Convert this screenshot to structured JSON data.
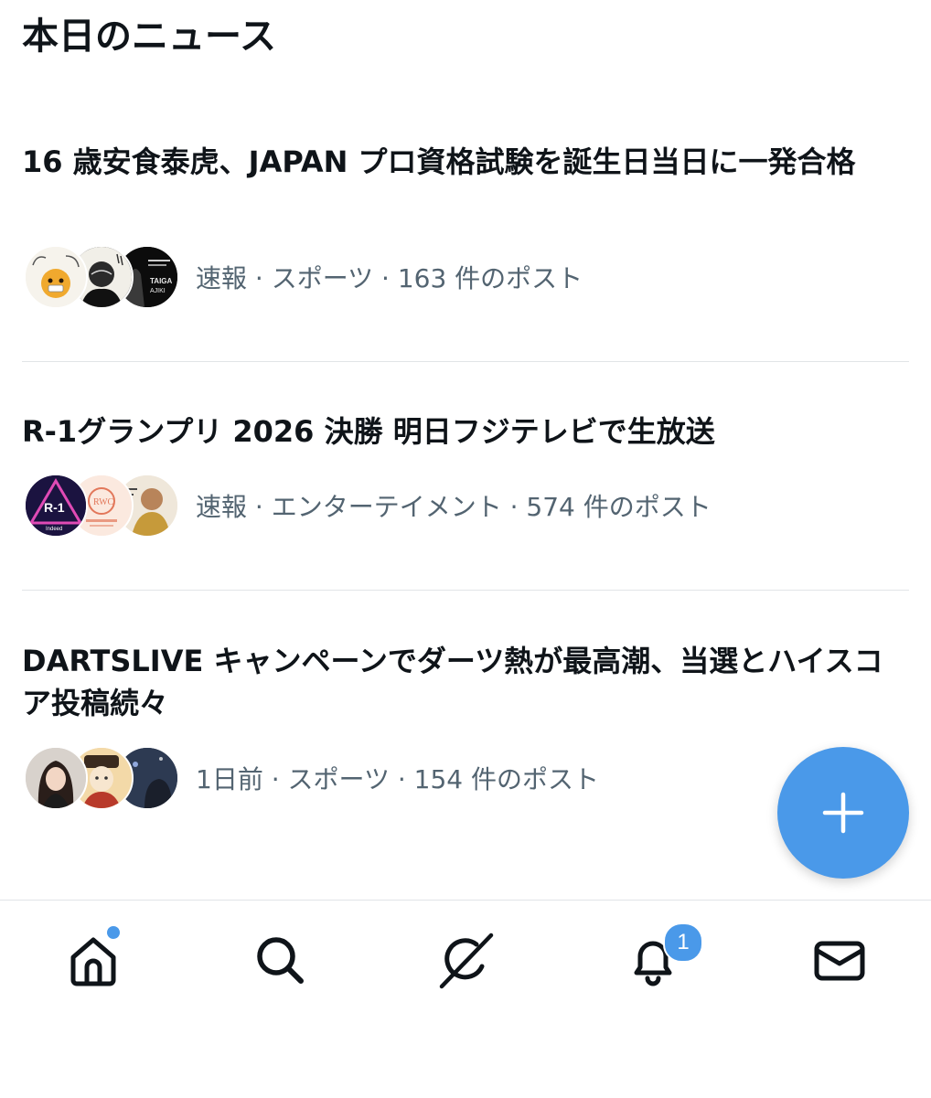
{
  "section": {
    "title": "本日のニュース"
  },
  "news": [
    {
      "headline": "16 歳安食泰虎、JAPAN プロ資格試験を誕生日当日に一発合格",
      "meta": "速報 · スポーツ · 163 件のポスト"
    },
    {
      "headline": "R-1グランプリ 2026 決勝 明日フジテレビで生放送",
      "meta": "速報 · エンターテイメント · 574 件のポスト"
    },
    {
      "headline": "DARTSLIVE キャンペーンでダーツ熱が最高潮、当選とハイスコア投稿続々",
      "meta": "1日前 · スポーツ · 154 件のポスト"
    }
  ],
  "avatar_images": {
    "item1": [
      "TAIGA",
      "AJIKI"
    ],
    "item2": [
      "R-1",
      "Indeed",
      "RWC"
    ]
  },
  "compose_button": {
    "icon": "plus-icon"
  },
  "tabbar": {
    "tabs": [
      {
        "name": "home",
        "icon": "home-icon",
        "has_dot": true
      },
      {
        "name": "search",
        "icon": "search-icon"
      },
      {
        "name": "grok",
        "icon": "grok-icon"
      },
      {
        "name": "notifications",
        "icon": "bell-icon",
        "badge": "1"
      },
      {
        "name": "messages",
        "icon": "mail-icon"
      }
    ]
  },
  "colors": {
    "accent": "#4a99e9",
    "text_primary": "#0f1419",
    "text_secondary": "#536471",
    "divider": "#e1e4e7"
  }
}
